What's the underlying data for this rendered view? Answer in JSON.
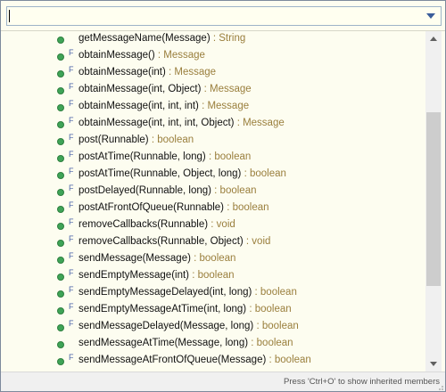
{
  "filter": {
    "value": ""
  },
  "members": [
    {
      "name": "getMessageName(Message)",
      "ret": " : String",
      "final": false
    },
    {
      "name": "obtainMessage()",
      "ret": " : Message",
      "final": true
    },
    {
      "name": "obtainMessage(int)",
      "ret": " : Message",
      "final": true
    },
    {
      "name": "obtainMessage(int, Object)",
      "ret": " : Message",
      "final": true
    },
    {
      "name": "obtainMessage(int, int, int)",
      "ret": " : Message",
      "final": true
    },
    {
      "name": "obtainMessage(int, int, int, Object)",
      "ret": " : Message",
      "final": true
    },
    {
      "name": "post(Runnable)",
      "ret": " : boolean",
      "final": true
    },
    {
      "name": "postAtTime(Runnable, long)",
      "ret": " : boolean",
      "final": true
    },
    {
      "name": "postAtTime(Runnable, Object, long)",
      "ret": " : boolean",
      "final": true
    },
    {
      "name": "postDelayed(Runnable, long)",
      "ret": " : boolean",
      "final": true
    },
    {
      "name": "postAtFrontOfQueue(Runnable)",
      "ret": " : boolean",
      "final": true
    },
    {
      "name": "removeCallbacks(Runnable)",
      "ret": " : void",
      "final": true
    },
    {
      "name": "removeCallbacks(Runnable, Object)",
      "ret": " : void",
      "final": true
    },
    {
      "name": "sendMessage(Message)",
      "ret": " : boolean",
      "final": true
    },
    {
      "name": "sendEmptyMessage(int)",
      "ret": " : boolean",
      "final": true
    },
    {
      "name": "sendEmptyMessageDelayed(int, long)",
      "ret": " : boolean",
      "final": true
    },
    {
      "name": "sendEmptyMessageAtTime(int, long)",
      "ret": " : boolean",
      "final": true
    },
    {
      "name": "sendMessageDelayed(Message, long)",
      "ret": " : boolean",
      "final": true
    },
    {
      "name": "sendMessageAtTime(Message, long)",
      "ret": " : boolean",
      "final": false
    },
    {
      "name": "sendMessageAtFrontOfQueue(Message)",
      "ret": " : boolean",
      "final": true
    }
  ],
  "final_marker": "F",
  "status": {
    "hint": "Press 'Ctrl+O' to show inherited members"
  },
  "colors": {
    "public_method": "#3fa457",
    "return_type": "#9a7f3d",
    "final_marker": "#4a63a8"
  },
  "icons": {
    "public": "public-method-icon",
    "final": "final-marker-icon"
  }
}
